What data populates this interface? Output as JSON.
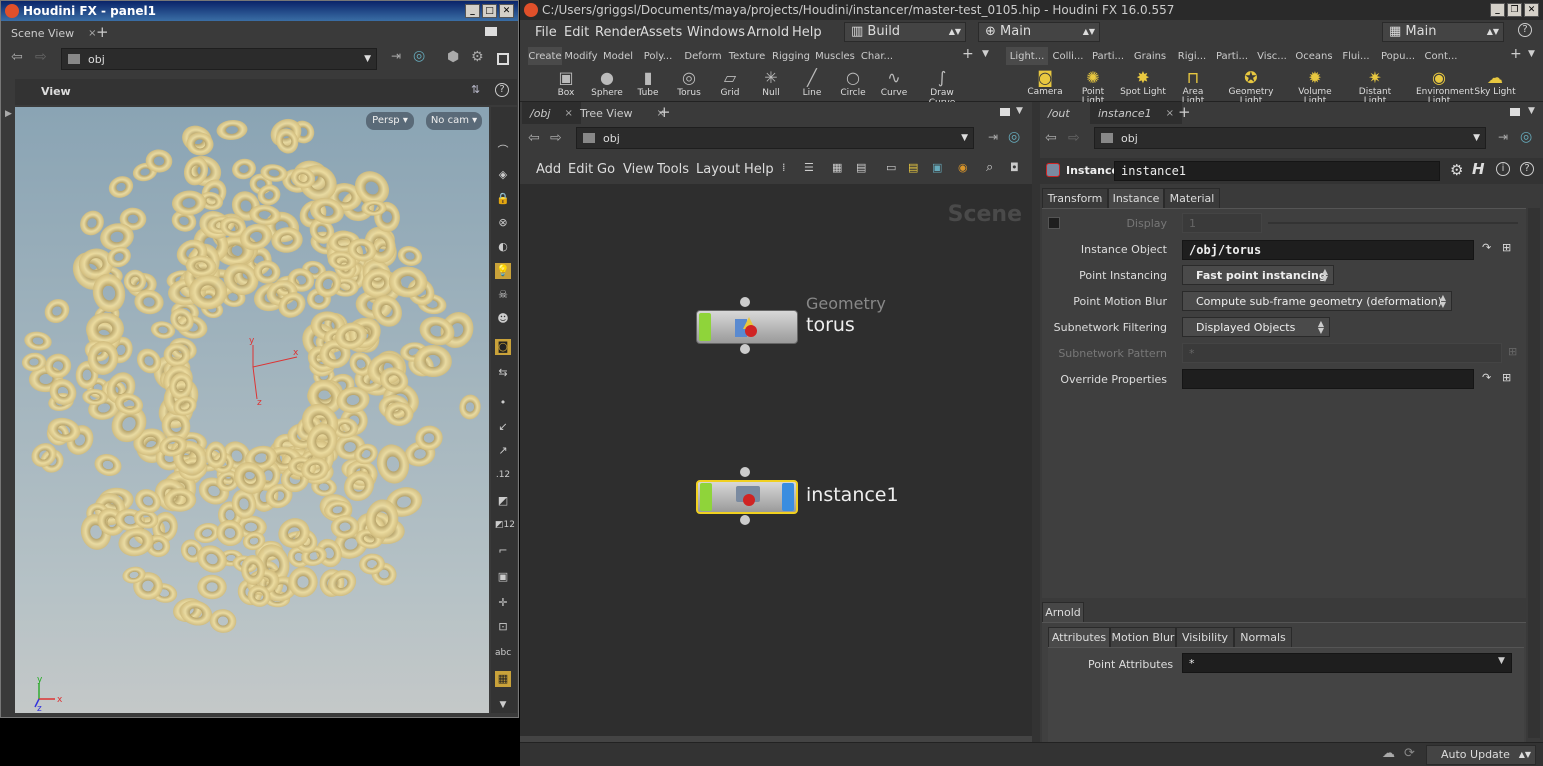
{
  "left_window": {
    "title": "Houdini FX - panel1",
    "tab": "Scene View",
    "path": "obj",
    "view_label": "View",
    "persp_btn": "Persp",
    "cam_btn": "No cam",
    "axis": {
      "x": "x",
      "y": "y",
      "z": "z"
    }
  },
  "main_window": {
    "title": "C:/Users/griggsl/Documents/maya/projects/Houdini/instancer/master-test_0105.hip - Houdini FX 16.0.557",
    "desktop": "Build",
    "context": "Main",
    "desktop2": "Main"
  },
  "menubar": [
    "File",
    "Edit",
    "Render",
    "Assets",
    "Windows",
    "Arnold",
    "Help"
  ],
  "shelf_tabs": [
    "Create",
    "Modify",
    "Model",
    "Poly...",
    "Deform",
    "Texture",
    "Rigging",
    "Muscles",
    "Char..."
  ],
  "shelf_tools": [
    "Box",
    "Sphere",
    "Tube",
    "Torus",
    "Grid",
    "Null",
    "Line",
    "Circle",
    "Curve",
    "Draw Curve"
  ],
  "light_tabs": [
    "Light...",
    "Colli...",
    "Parti...",
    "Grains",
    "Rigi...",
    "Parti...",
    "Visc...",
    "Oceans",
    "Flui...",
    "Popu...",
    "Cont..."
  ],
  "light_tools": [
    "Camera",
    "Point Light",
    "Spot Light",
    "Area Light",
    "Geometry Light",
    "Volume Light",
    "Distant Light",
    "Environment Light",
    "Sky Light"
  ],
  "network": {
    "tabs": [
      "/obj",
      "Tree View"
    ],
    "path": "obj",
    "menu": [
      "Add",
      "Edit",
      "Go",
      "View",
      "Tools",
      "Layout",
      "Help"
    ],
    "watermark": "Scene",
    "nodes": [
      {
        "type": "Geometry",
        "name": "torus"
      },
      {
        "name": "instance1"
      }
    ]
  },
  "params": {
    "tabs": [
      "/out",
      "instance1"
    ],
    "path": "obj",
    "node_type": "Instance",
    "node_name": "instance1",
    "folder_tabs": [
      "Transform",
      "Instance",
      "Material"
    ],
    "display_label": "Display",
    "display_value": "1",
    "instance_object_label": "Instance Object",
    "instance_object": "/obj/torus",
    "point_instancing_label": "Point Instancing",
    "point_instancing": "Fast point instancing",
    "motion_blur_label": "Point Motion Blur",
    "motion_blur": "Compute sub-frame geometry (deformation)",
    "subnet_filter_label": "Subnetwork Filtering",
    "subnet_filter": "Displayed Objects",
    "subnet_pattern_label": "Subnetwork Pattern",
    "subnet_pattern": "*",
    "override_label": "Override Properties",
    "arnold_tab": "Arnold",
    "arnold_tabs": [
      "Attributes",
      "Motion Blur",
      "Visibility",
      "Normals"
    ],
    "point_attr_label": "Point Attributes",
    "point_attr": "*"
  },
  "status": {
    "auto_update": "Auto Update"
  }
}
